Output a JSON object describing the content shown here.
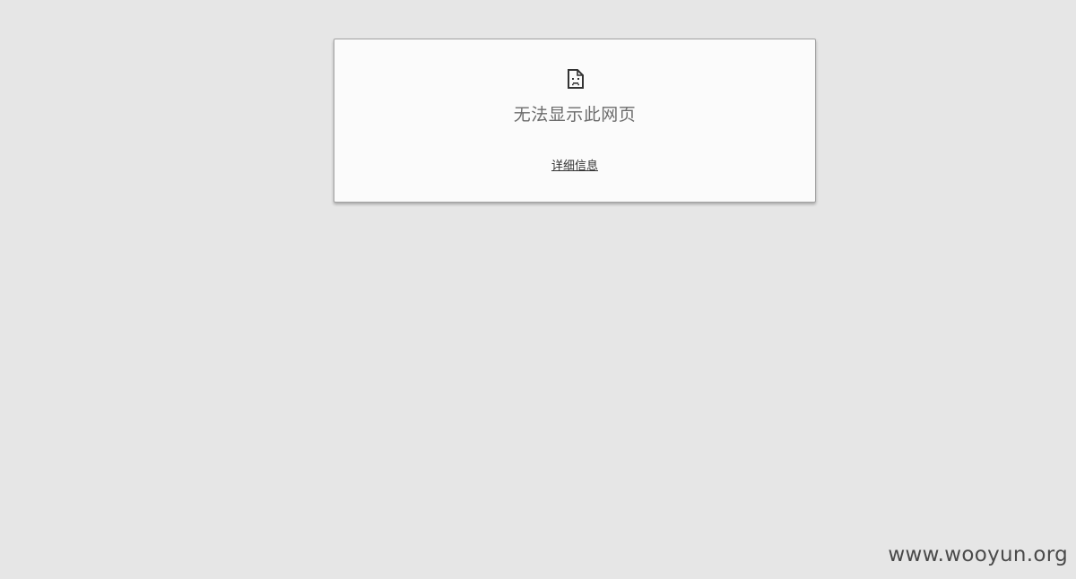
{
  "error": {
    "icon": "sad-page-icon",
    "title": "无法显示此网页",
    "details_link": "详细信息"
  },
  "watermark": {
    "text": "www.wooyun.org"
  },
  "colors": {
    "page_background": "#e6e6e6",
    "card_background": "#fbfbfb",
    "card_border": "#a3a3a3",
    "title_text": "#6b6b6b",
    "link_text": "#333333",
    "watermark_text": "#4a4a4a"
  }
}
